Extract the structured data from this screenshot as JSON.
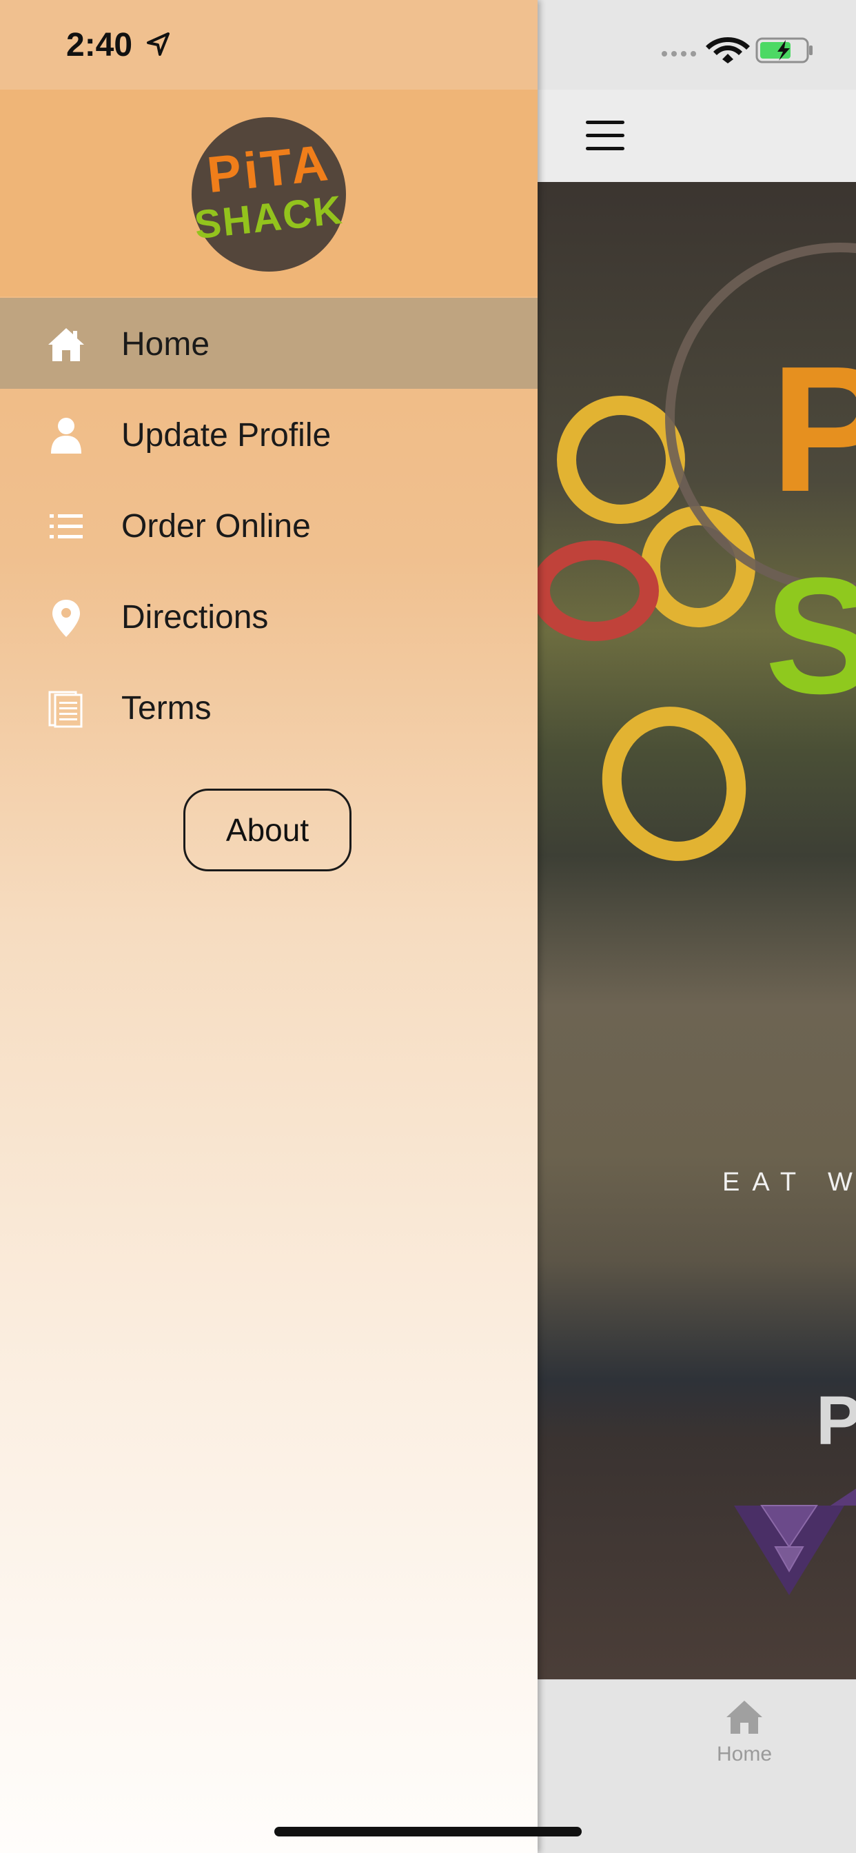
{
  "status_bar": {
    "time": "2:40"
  },
  "drawer": {
    "logo": {
      "line1": "PiTA",
      "line2": "SHACK"
    },
    "menu": [
      {
        "label": "Home",
        "icon": "home-icon",
        "active": true
      },
      {
        "label": "Update Profile",
        "icon": "user-icon",
        "active": false
      },
      {
        "label": "Order Online",
        "icon": "list-icon",
        "active": false
      },
      {
        "label": "Directions",
        "icon": "location-pin-icon",
        "active": false
      },
      {
        "label": "Terms",
        "icon": "document-icon",
        "active": false
      }
    ],
    "about_label": "About"
  },
  "app": {
    "hero": {
      "tagline": "EAT WE",
      "partial_text": "PC"
    },
    "tabbar": {
      "home_label": "Home"
    }
  },
  "colors": {
    "drawer_top": "#efb576",
    "active_item": "#bfa480",
    "logo_bg": "#54463b",
    "logo_orange": "#f07e1a",
    "logo_green": "#93c31d"
  }
}
